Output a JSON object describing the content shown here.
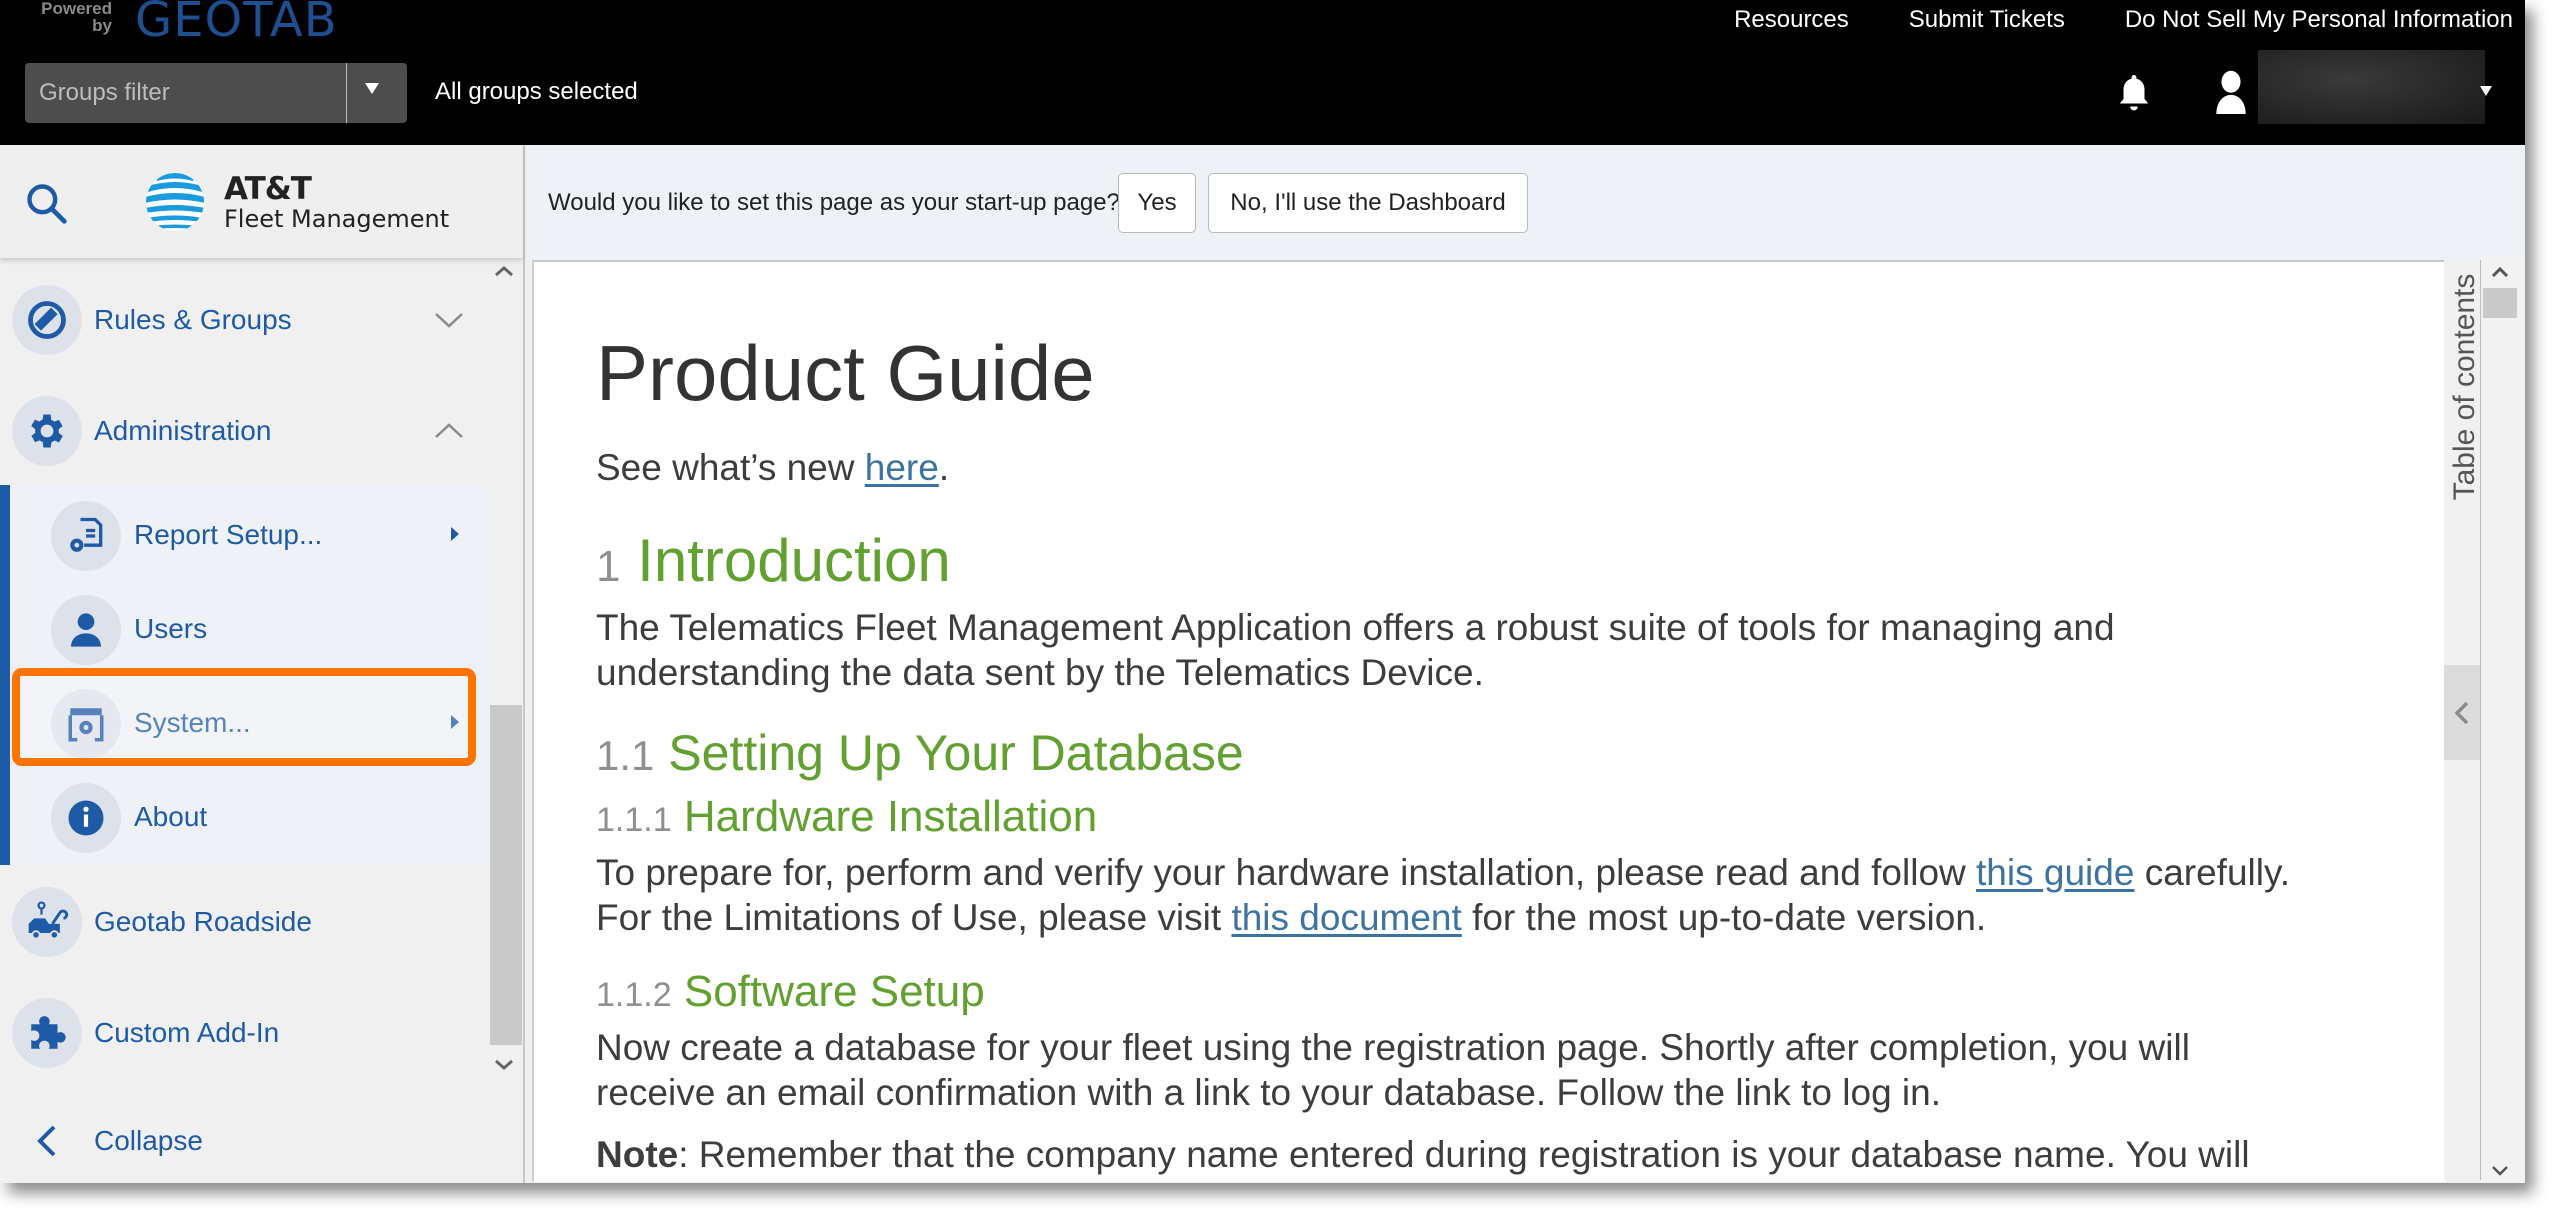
{
  "header": {
    "powered_by": "Powered by",
    "brand": "GEOTAB",
    "links": [
      "Resources",
      "Submit Tickets",
      "Do Not Sell My Personal Information"
    ],
    "groups_filter_placeholder": "Groups filter",
    "groups_status": "All groups selected",
    "icons": {
      "notifications": "bell-icon",
      "user": "user-icon",
      "user_menu": "caret-down-icon"
    }
  },
  "sidebar": {
    "logo": {
      "name": "AT&T",
      "subtitle": "Fleet Management"
    },
    "items": [
      {
        "label": "Rules & Groups",
        "icon": "rules-icon",
        "state": "collapsed"
      },
      {
        "label": "Administration",
        "icon": "gear-icon",
        "state": "expanded"
      }
    ],
    "subitems": [
      {
        "label": "Report Setup...",
        "icon": "report-setup-icon",
        "has_submenu": true
      },
      {
        "label": "Users",
        "icon": "user-icon",
        "has_submenu": false
      },
      {
        "label": "System...",
        "icon": "system-settings-icon",
        "has_submenu": true,
        "highlighted": true
      },
      {
        "label": "About",
        "icon": "info-icon",
        "has_submenu": false
      }
    ],
    "more_items": [
      {
        "label": "Geotab Roadside",
        "icon": "roadside-tow-icon"
      },
      {
        "label": "Custom Add-In",
        "icon": "puzzle-icon"
      }
    ],
    "collapse_label": "Collapse"
  },
  "startup_prompt": {
    "question": "Would you like to set this page as your start-up page?",
    "yes_label": "Yes",
    "no_label": "No, I'll use the Dashboard"
  },
  "document": {
    "title": "Product Guide",
    "whats_new": {
      "before": "See what’s new ",
      "link": "here",
      "after": "."
    },
    "sections": {
      "intro": {
        "num": "1",
        "title": "Introduction",
        "line1": "The Telematics Fleet Management Application offers a robust suite of tools for managing and",
        "line2": "understanding the data sent by the Telematics Device."
      },
      "db": {
        "num": "1.1",
        "title": "Setting Up Your Database"
      },
      "hw": {
        "num": "1.1.1",
        "title": "Hardware Installation",
        "line1_before": "To prepare for, perform and verify your hardware installation, please read and follow ",
        "line1_link": "this guide",
        "line1_after": " carefully.",
        "line2_before": "For the Limitations of Use, please visit ",
        "line2_link": "this document",
        "line2_after": " for the most up-to-date version."
      },
      "sw": {
        "num": "1.1.2",
        "title": "Software Setup",
        "line1": "Now create a database for your fleet using the registration page. Shortly after completion, you will",
        "line2": "receive an email confirmation with a link to your database. Follow the link to log in.",
        "note_label": "Note",
        "note_text": ": Remember that the company name entered during registration is your database name. You will"
      }
    }
  },
  "toc": {
    "label": "Table of contents"
  },
  "colors": {
    "nav_blue": "#1f5aa6",
    "heading_green": "#62a030",
    "highlight_orange": "#ff7300",
    "link_blue": "#3d73a0"
  }
}
